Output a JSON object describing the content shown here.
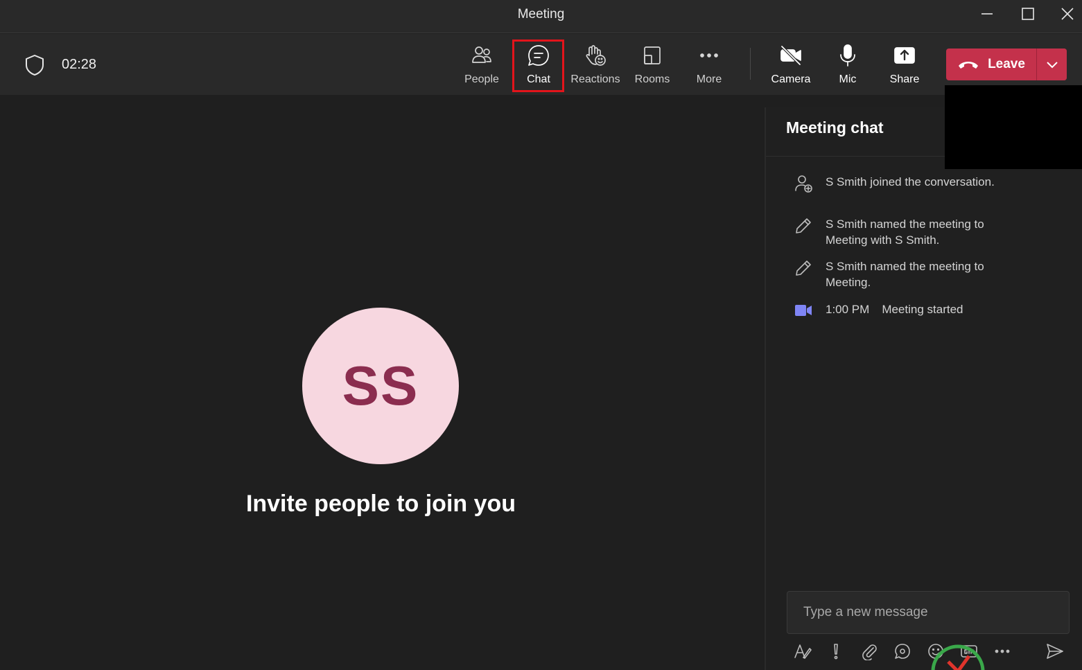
{
  "window": {
    "title": "Meeting"
  },
  "toolbar": {
    "timer": "02:28",
    "buttons": {
      "people": "People",
      "chat": "Chat",
      "reactions": "Reactions",
      "rooms": "Rooms",
      "more": "More",
      "camera": "Camera",
      "mic": "Mic",
      "share": "Share"
    },
    "leave_label": "Leave"
  },
  "stage": {
    "avatar_initials": "SS",
    "invite_text": "Invite people to join you"
  },
  "chat": {
    "title": "Meeting chat",
    "messages": [
      {
        "icon": "person-add-icon",
        "text": "S Smith joined the conversation."
      },
      {
        "icon": "pencil-icon",
        "text": "S Smith named the meeting to Meeting with S Smith."
      },
      {
        "icon": "pencil-icon",
        "text": "S Smith named the meeting to Meeting."
      }
    ],
    "started": {
      "icon": "video-icon",
      "time": "1:00 PM",
      "text": "Meeting started"
    },
    "compose_placeholder": "Type a new message"
  },
  "colors": {
    "leave_button": "#c4314b",
    "avatar_bg": "#f7d7e0",
    "avatar_text": "#8b2d4f",
    "highlight_box": "#e3141b",
    "video_icon": "#7f85f5"
  }
}
